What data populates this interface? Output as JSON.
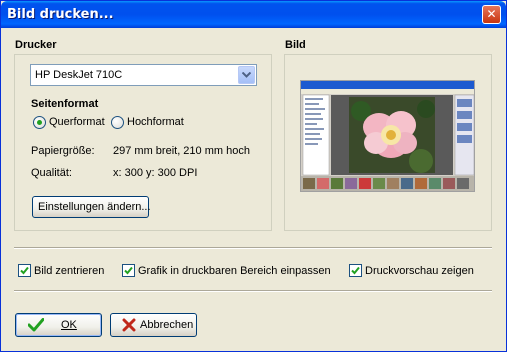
{
  "window": {
    "title": "Bild drucken...",
    "close_symbol": "✕"
  },
  "printer": {
    "group_label": "Drucker",
    "selected_printer": "HP DeskJet 710C",
    "page_format_label": "Seitenformat",
    "orientation_options": [
      {
        "label": "Querformat",
        "checked": true
      },
      {
        "label": "Hochformat",
        "checked": false
      }
    ],
    "paper_size_label": "Papiergröße:",
    "paper_size_value": "297 mm breit, 210 mm hoch",
    "quality_label": "Qualität:",
    "quality_value": "x: 300 y: 300 DPI",
    "settings_button": "Einstellungen ändern..."
  },
  "preview": {
    "group_label": "Bild"
  },
  "options": [
    {
      "label": "Bild zentrieren",
      "checked": true
    },
    {
      "label": "Grafik in druckbaren Bereich einpassen",
      "checked": true
    },
    {
      "label": "Druckvorschau zeigen",
      "checked": true
    }
  ],
  "buttons": {
    "ok": "OK",
    "cancel": "Abbrechen"
  },
  "colors": {
    "titlebar": "#0054e3",
    "face": "#ece9d8",
    "check": "#21a121",
    "cancel_x": "#c0281a"
  }
}
